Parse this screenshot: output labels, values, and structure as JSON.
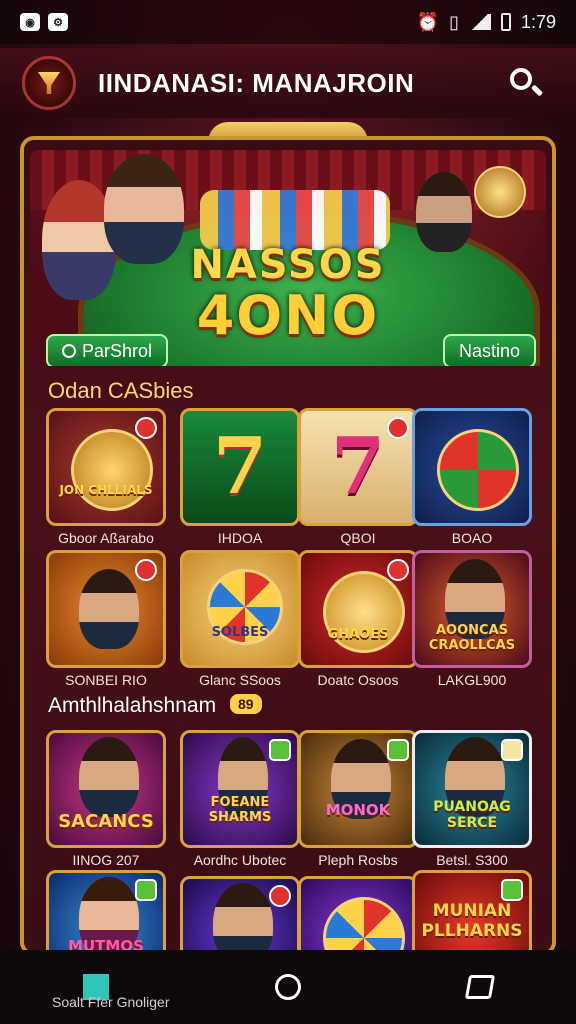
{
  "status_bar": {
    "time": "1:79",
    "left_icons": [
      "notification-icon",
      "settings-icon"
    ],
    "right_icons": [
      "alarm-icon",
      "vibrate-icon",
      "signal-icon",
      "battery-icon"
    ]
  },
  "header": {
    "title": "IINDANASI: MANAJROIN"
  },
  "hero": {
    "title_line1": "NASSOS",
    "title_line2": "4ONO",
    "left_button": "ParShrol",
    "right_button": "Nastino"
  },
  "sections": {
    "section1_title": "Odan CASbies",
    "section2_title": "Amthlhalahshnam",
    "section2_badge": "89"
  },
  "games_row1": [
    {
      "label": "Gboor Aßarabo",
      "art": "JON CHLLIALS"
    },
    {
      "label": "IHDOA",
      "art": "7"
    },
    {
      "label": "QBOI",
      "art": "7"
    },
    {
      "label": "BOAO",
      "art": ""
    }
  ],
  "games_row2": [
    {
      "label": "SONBEI RIO",
      "art": ""
    },
    {
      "label": "Glanc SSoos",
      "art": "SOLBES"
    },
    {
      "label": "Doatc Osoos",
      "art": "GHAOES"
    },
    {
      "label": "LAKGL900",
      "art": "AOONCAS CRAOLLCAS"
    }
  ],
  "games_row3": [
    {
      "label": "IINOG 207",
      "art": "SACANCS"
    },
    {
      "label": "Aordhc Ubotec",
      "art": "FOEANE SHARMS"
    },
    {
      "label": "Pleph Rosbs",
      "art": "MONOK"
    },
    {
      "label": "Betsl. S300",
      "art": "PUANOAG SERCE"
    }
  ],
  "games_row4": [
    {
      "label": "Soalt Ffer Gnoliger",
      "art": "MUTMOS ROWCE"
    },
    {
      "label": "",
      "art": ""
    },
    {
      "label": "",
      "art": ""
    },
    {
      "label": "",
      "art": "MUNIAN PLLHARNS"
    }
  ],
  "nav": {
    "icons": [
      "recents-icon",
      "home-icon",
      "back-icon"
    ]
  }
}
